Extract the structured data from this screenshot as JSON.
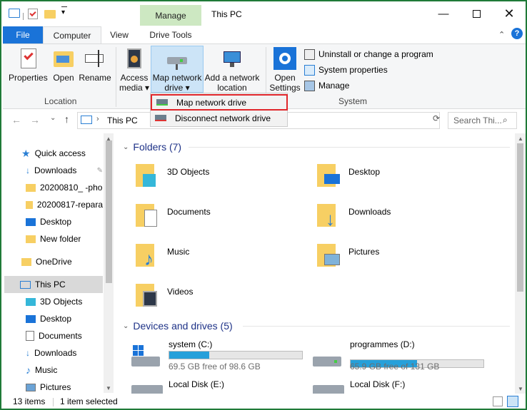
{
  "title": "This PC",
  "context_tab": "Manage",
  "tabs": [
    "File",
    "Computer",
    "View",
    "Drive Tools"
  ],
  "ribbon": {
    "properties": "Properties",
    "open": "Open",
    "rename": "Rename",
    "location_group": "Location",
    "access_media": [
      "Access",
      "media ▾"
    ],
    "map_network": [
      "Map network",
      "drive ▾"
    ],
    "add_network": [
      "Add a network",
      "location"
    ],
    "open_settings": [
      "Open",
      "Settings"
    ],
    "uninstall": "Uninstall or change a program",
    "sys_props": "System properties",
    "manage": "Manage",
    "system_group": "System"
  },
  "dropdown": {
    "map": "Map network drive",
    "disconnect": "Disconnect network drive"
  },
  "address": {
    "path": "This PC",
    "search_placeholder": "Search Thi..."
  },
  "nav": {
    "quick_access": "Quick access",
    "items": [
      "Downloads",
      "20200810_ -pho",
      "20200817-repara",
      "Desktop",
      "New folder"
    ],
    "onedrive": "OneDrive",
    "thispc": "This PC",
    "pc_items": [
      "3D Objects",
      "Desktop",
      "Documents",
      "Downloads",
      "Music",
      "Pictures"
    ]
  },
  "folders_header": "Folders (7)",
  "folders": [
    "3D Objects",
    "Desktop",
    "Documents",
    "Downloads",
    "Music",
    "Pictures",
    "Videos"
  ],
  "drives_header": "Devices and drives (5)",
  "drives": [
    {
      "name": "system (C:)",
      "free": "69.5 GB free of 98.6 GB",
      "used": 0.3
    },
    {
      "name": "programmes (D:)",
      "free": "65.9 GB free of 131 GB",
      "used": 0.5
    },
    {
      "name": "Local Disk (E:)"
    },
    {
      "name": "Local Disk (F:)"
    }
  ],
  "status": {
    "count": "13 items",
    "selected": "1 item selected"
  },
  "colors": {
    "accent": "#1a73d8",
    "context": "#cde8c2",
    "highlight": "#e0262a",
    "folder": "#f7cf63"
  }
}
